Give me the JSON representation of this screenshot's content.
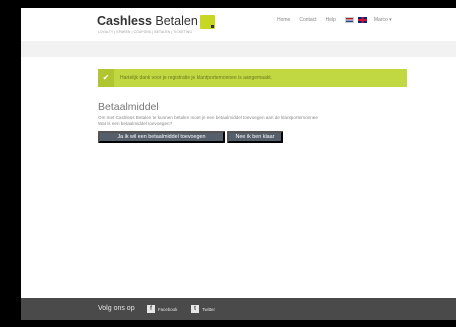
{
  "header": {
    "logo_bold": "Cashless",
    "logo_regular": "Betalen",
    "tagline": "LOYALTY | SPAREN | COUPONS | BETALEN | TICKETING",
    "nav": [
      {
        "label": "Home"
      },
      {
        "label": "Contact"
      },
      {
        "label": "Help"
      }
    ],
    "user_menu": "Marco ▾"
  },
  "alert": {
    "message": "Hartelijk dank voor je registratie je klantportemonnee is aangemaakt."
  },
  "main": {
    "title": "Betaalmiddel",
    "desc_line1": "Om met Cashless Betalen te kunnen betalen moet je een betaalmiddel toevoegen aan de klantportemonnee",
    "desc_line2": "Wat is een betaalmiddel toevoegen?",
    "btn_add": "Ja ik wil een betaalmiddel toevoegen",
    "btn_done": "Nee ik ben klaar"
  },
  "footer": {
    "follow_label": "Volg ons op",
    "facebook": "Facebook",
    "twitter": "Twitter"
  },
  "colors": {
    "accent": "#c2d843",
    "button": "#555f6b",
    "footer": "#4a4a4a"
  }
}
